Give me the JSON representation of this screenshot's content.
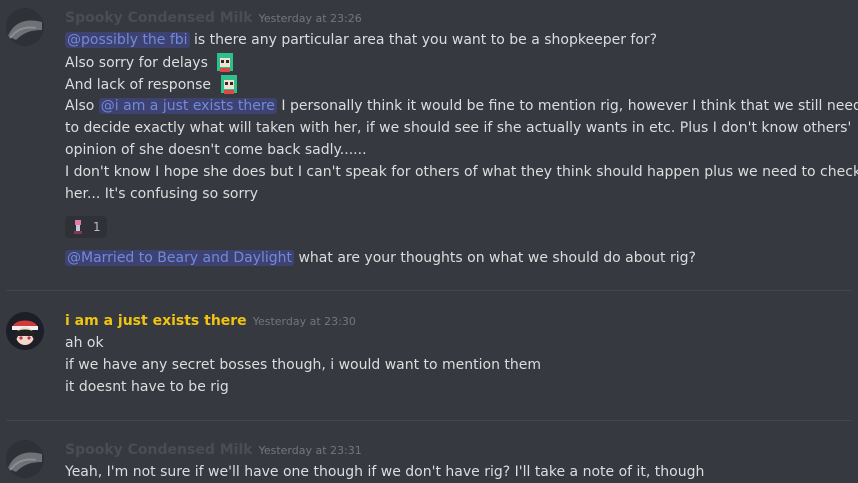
{
  "messages": [
    {
      "author": "Spooky Condensed Milk",
      "timestamp": "Yesterday at 23:26",
      "lines": {
        "l1_mention": "@possibly the fbi",
        "l1_text": " is there any particular area that you want to be a shopkeeper for?",
        "l2": "Also sorry for delays",
        "l3": "And lack of response",
        "l4_pre": "Also ",
        "l4_mention": "@i am a just exists there",
        "l4_text": " I personally think it would be fine to mention rig, however I think that we still need",
        "l5": "to decide exactly what will taken with her, if  we should see if she actually wants in etc. Plus I don't know others'",
        "l6": "opinion of she doesn't come back sadly......",
        "l7": "I don't know I hope she does but I can't speak for others of what they think should happen plus we need to check with",
        "l8": "her... It's confusing so sorry"
      },
      "reaction_count": "1",
      "followup_mention": "@Married to Beary and Daylight",
      "followup_text": " what are your thoughts on what we should do about rig?"
    },
    {
      "author": "i am a just exists there",
      "timestamp": "Yesterday at 23:30",
      "lines": [
        "ah ok",
        "if we have any secret bosses though, i would want to mention them",
        "it doesnt have to be rig"
      ]
    },
    {
      "author": "Spooky Condensed Milk",
      "timestamp": "Yesterday at 23:31",
      "lines": [
        "Yeah, I'm not sure if we'll have one though if we don't have rig? I'll take a note of it, though"
      ]
    }
  ],
  "colors": {
    "background": "#36393f",
    "username_faded": "#4a4d53",
    "username_yellow": "#f1c40f",
    "mention_text": "#7289da",
    "mention_bg": "#3e4270",
    "timestamp": "#72767d"
  },
  "icons": {
    "emoji": "anime-girl-green-hair-emoji",
    "reaction": "pink-character-emoji"
  }
}
